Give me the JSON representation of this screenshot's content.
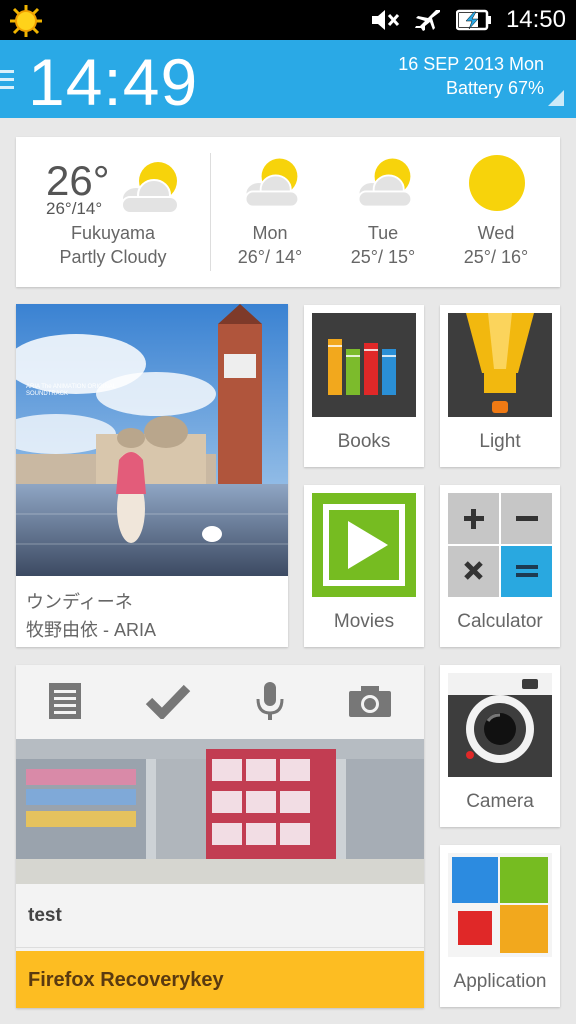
{
  "status_bar": {
    "time": "14:50",
    "icons": [
      "sun-icon",
      "mute-icon",
      "airplane-icon",
      "battery-charging-icon"
    ]
  },
  "header": {
    "time": "14:49",
    "date": "16 SEP 2013 Mon",
    "battery": "Battery 67%"
  },
  "weather": {
    "current": {
      "temp": "26°",
      "range": "26°/14°",
      "city": "Fukuyama",
      "condition": "Partly Cloudy"
    },
    "forecast": [
      {
        "day": "Mon",
        "temps": "26°/ 14°",
        "icon": "partly-cloudy-icon"
      },
      {
        "day": "Tue",
        "temps": "25°/ 15°",
        "icon": "partly-cloudy-icon"
      },
      {
        "day": "Wed",
        "temps": "25°/ 16°",
        "icon": "sunny-icon"
      }
    ]
  },
  "music": {
    "title": "ウンディーネ",
    "artist": "牧野由依 - ARIA",
    "album_text": "ARIA The ANIMATION ORIGINAL SOUNDTRACK"
  },
  "apps": {
    "books": "Books",
    "light": "Light",
    "movies": "Movies",
    "calculator": "Calculator",
    "camera": "Camera",
    "application": "Application"
  },
  "notes": {
    "toolbar": [
      "list-icon",
      "check-icon",
      "mic-icon",
      "camera-icon"
    ],
    "note_title": "test",
    "highlight": "Firefox Recoverykey"
  },
  "colors": {
    "header": "#2aa9e6",
    "note_highlight": "#fdbd22",
    "sun": "#f7d30b",
    "movies": "#76bc21",
    "calc_equals": "#29a8e0"
  }
}
